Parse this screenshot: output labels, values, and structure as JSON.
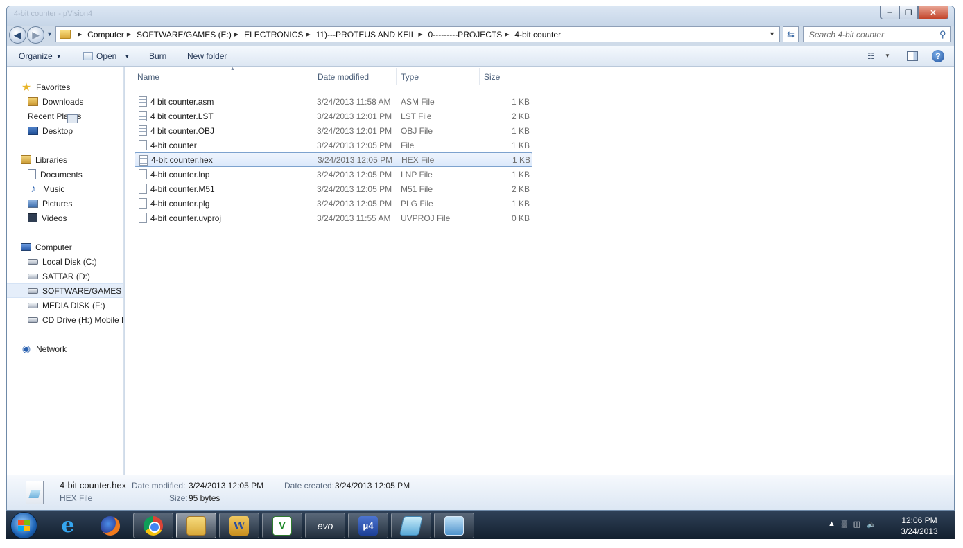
{
  "window": {
    "title_ghost": "4-bit counter - µVision4",
    "buttons": {
      "minimize": "–",
      "maximize": "❐",
      "close": "✕"
    }
  },
  "address": {
    "breadcrumbs": [
      "Computer",
      "SOFTWARE/GAMES (E:)",
      "ELECTRONICS",
      "11)---PROTEUS AND KEIL",
      "0---------PROJECTS",
      "4-bit counter"
    ],
    "search_placeholder": "Search 4-bit counter"
  },
  "toolbar": {
    "organize": "Organize",
    "open": "Open",
    "burn": "Burn",
    "new_folder": "New folder"
  },
  "nav": {
    "favorites": {
      "label": "Favorites",
      "items": [
        "Downloads",
        "Recent Places",
        "Desktop"
      ]
    },
    "libraries": {
      "label": "Libraries",
      "items": [
        "Documents",
        "Music",
        "Pictures",
        "Videos"
      ]
    },
    "computer": {
      "label": "Computer",
      "items": [
        "Local Disk (C:)",
        "SATTAR (D:)",
        "SOFTWARE/GAMES (E",
        "MEDIA DISK (F:)",
        "CD Drive (H:) Mobile P"
      ]
    },
    "network": {
      "label": "Network"
    }
  },
  "columns": {
    "name": "Name",
    "date": "Date modified",
    "type": "Type",
    "size": "Size"
  },
  "files": [
    {
      "name": "4 bit counter.asm",
      "date": "3/24/2013 11:58 AM",
      "type": "ASM File",
      "size": "1 KB"
    },
    {
      "name": "4 bit counter.LST",
      "date": "3/24/2013 12:01 PM",
      "type": "LST File",
      "size": "2 KB"
    },
    {
      "name": "4 bit counter.OBJ",
      "date": "3/24/2013 12:01 PM",
      "type": "OBJ File",
      "size": "1 KB"
    },
    {
      "name": "4-bit counter",
      "date": "3/24/2013 12:05 PM",
      "type": "File",
      "size": "1 KB"
    },
    {
      "name": "4-bit counter.hex",
      "date": "3/24/2013 12:05 PM",
      "type": "HEX File",
      "size": "1 KB"
    },
    {
      "name": "4-bit counter.lnp",
      "date": "3/24/2013 12:05 PM",
      "type": "LNP File",
      "size": "1 KB"
    },
    {
      "name": "4-bit counter.M51",
      "date": "3/24/2013 12:05 PM",
      "type": "M51 File",
      "size": "2 KB"
    },
    {
      "name": "4-bit counter.plg",
      "date": "3/24/2013 12:05 PM",
      "type": "PLG File",
      "size": "1 KB"
    },
    {
      "name": "4-bit counter.uvproj",
      "date": "3/24/2013 11:55 AM",
      "type": "UVPROJ File",
      "size": "0 KB"
    }
  ],
  "details": {
    "name": "4-bit counter.hex",
    "type": "HEX File",
    "date_modified_label": "Date modified:",
    "date_modified": "3/24/2013 12:05 PM",
    "date_created_label": "Date created:",
    "date_created": "3/24/2013 12:05 PM",
    "size_label": "Size:",
    "size": "95 bytes"
  },
  "taskbar": {
    "apps": [
      "internet-explorer",
      "firefox",
      "chrome",
      "windows-explorer",
      "word",
      "vikings",
      "evo",
      "keil-uvision4",
      "hex-file",
      "screen"
    ],
    "clock_time": "12:06 PM",
    "clock_date": "3/24/2013",
    "tray_expand": "▲"
  },
  "colors": {
    "selection": "#dce9fb",
    "selection_border": "#7da2ce",
    "toolbar": "#dde7f3",
    "taskbar": "#13202f"
  }
}
